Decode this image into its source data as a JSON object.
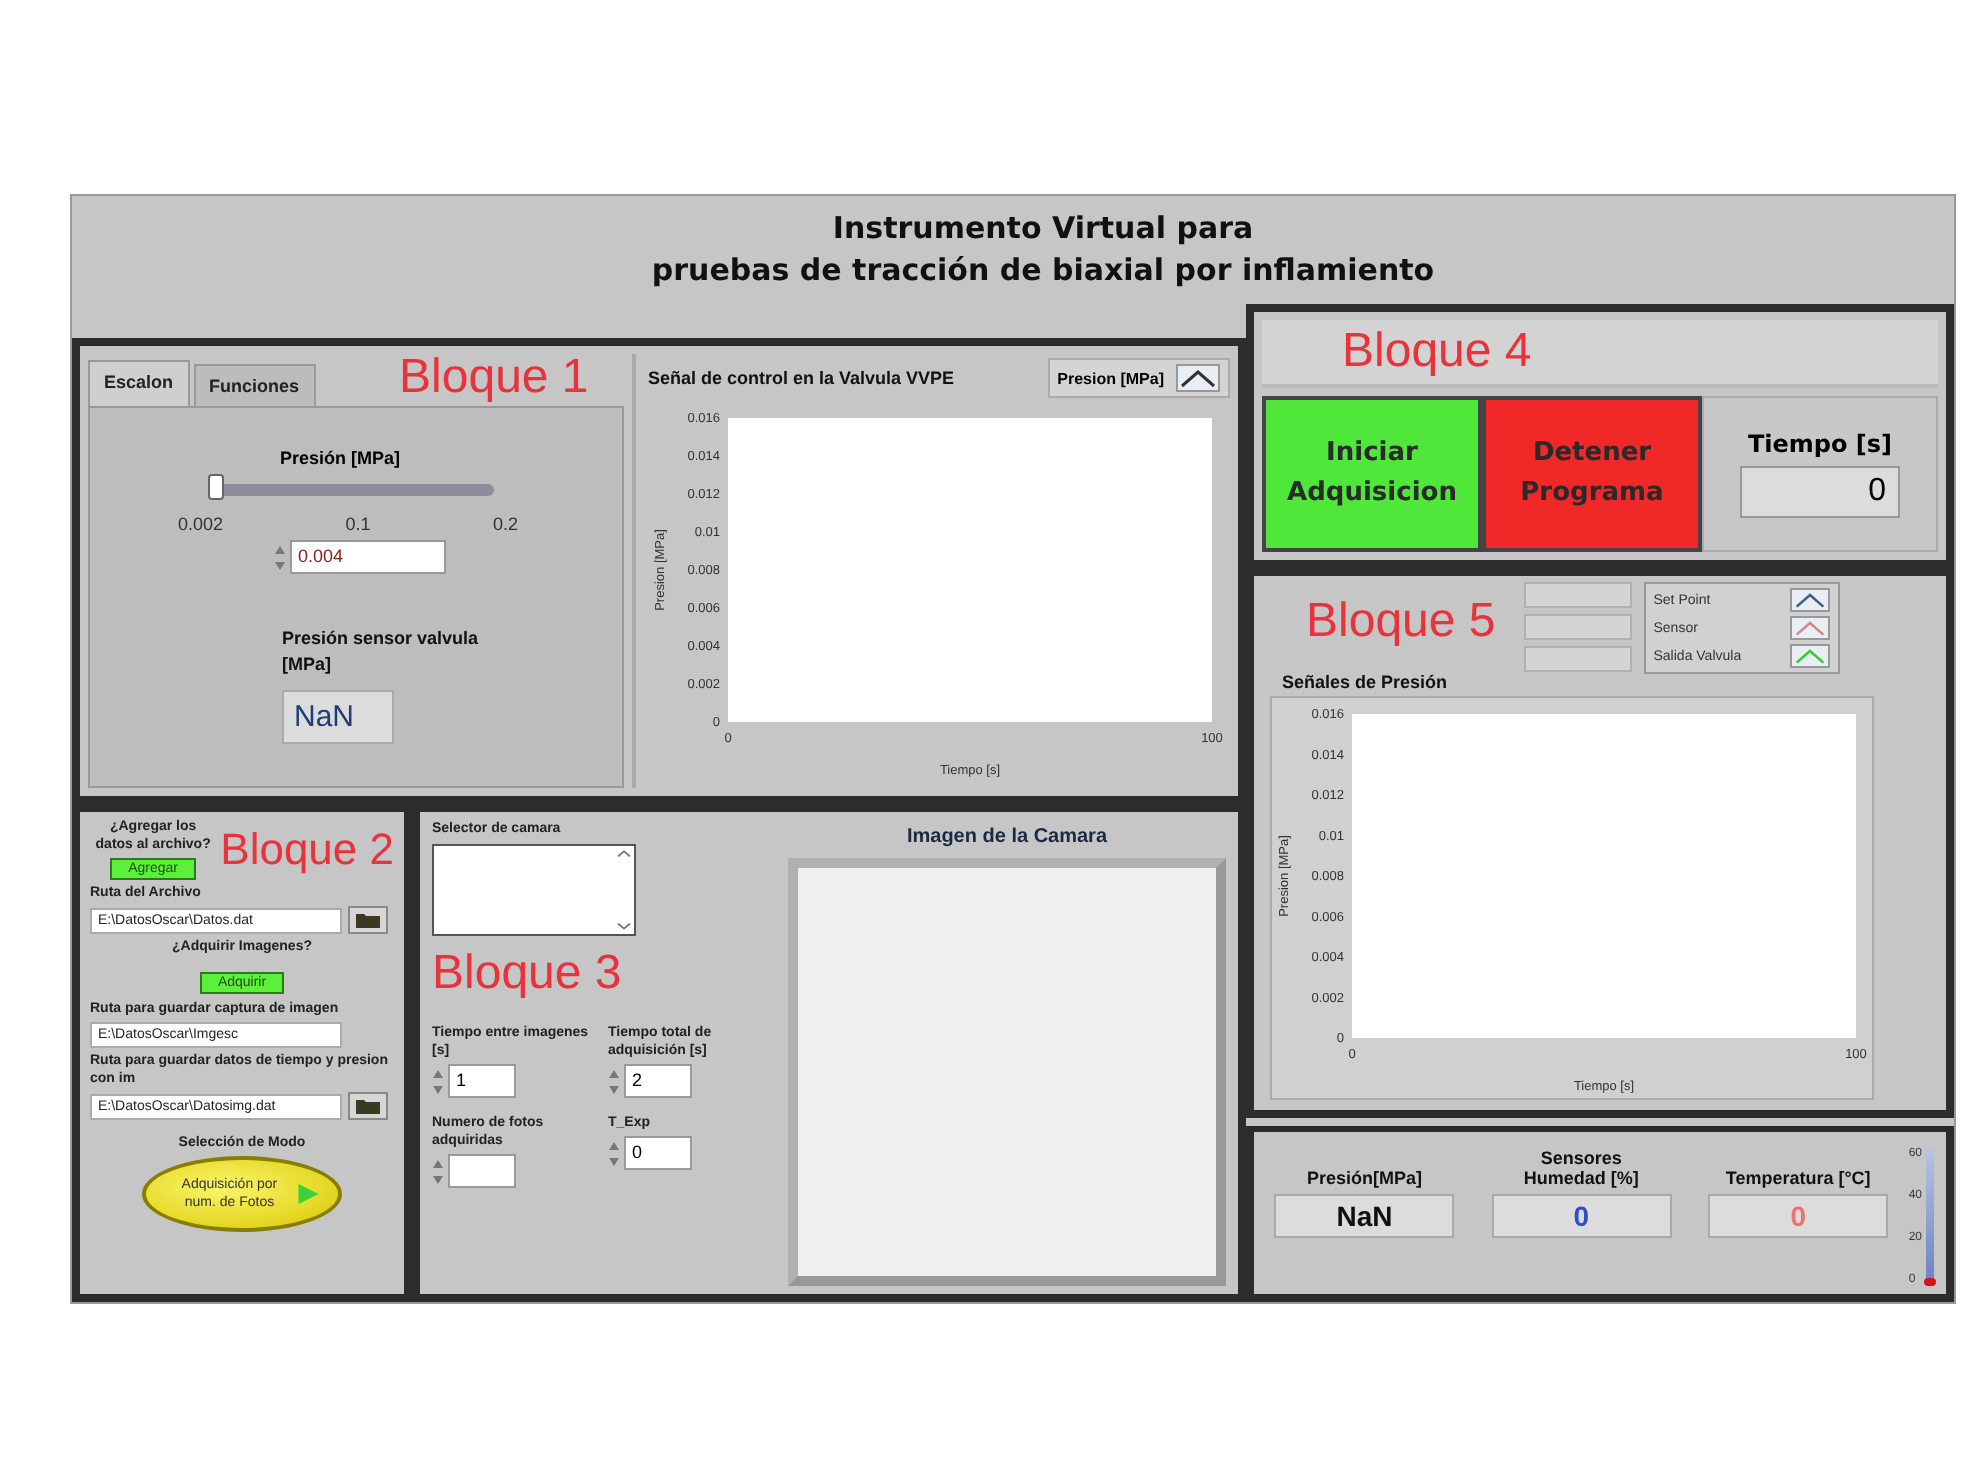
{
  "title": "Instrumento Virtual para\npruebas de tracción de biaxial por inflamiento",
  "bloque1": {
    "label": "Bloque 1",
    "tabs": [
      {
        "label": "Escalon",
        "selected": true
      },
      {
        "label": "Funciones",
        "selected": false
      }
    ],
    "slider": {
      "label": "Presión [MPa]",
      "level": 0.01,
      "ticks": [
        "0.002",
        "0.1",
        "0.2"
      ],
      "value": "0.004"
    },
    "sensor": {
      "label": "Presión sensor valvula [MPa]",
      "value": "NaN"
    },
    "chart": {
      "title": "Señal de control en la Valvula VVPE",
      "legend": "Presion [MPa]",
      "chart_data": {
        "type": "line",
        "xlabel": "Tiempo [s]",
        "ylabel": "Presion [MPa]",
        "xlim": [
          0,
          100
        ],
        "ylim": [
          0,
          0.016
        ],
        "xticks": [
          0,
          100
        ],
        "yticks": [
          0,
          0.002,
          0.004,
          0.006,
          0.008,
          0.01,
          0.012,
          0.014,
          0.016
        ]
      }
    }
  },
  "bloque2": {
    "label": "Bloque 2",
    "agregar": {
      "label": "¿Agregar los datos al archivo?",
      "button": "Agregar"
    },
    "ruta_archivo": {
      "label": "Ruta del Archivo",
      "value": "E:\\DatosOscar\\Datos.dat"
    },
    "adquirir": {
      "label": "¿Adquirir Imagenes?",
      "button": "Adquirir"
    },
    "ruta_imagen": {
      "label": "Ruta para guardar captura de imagen",
      "value": "E:\\DatosOscar\\Imgesc"
    },
    "ruta_datos": {
      "label": "Ruta para guardar datos de tiempo y presion con im",
      "value": "E:\\DatosOscar\\Datosimg.dat"
    },
    "modo": {
      "label": "Selección de Modo",
      "value": "Adquisición por num. de Fotos",
      "on": true
    }
  },
  "bloque3": {
    "label": "Bloque 3",
    "selector": "Selector de camara",
    "image_title": "Imagen de la Camara",
    "fields": [
      {
        "label": "Tiempo entre imagenes [s]",
        "value": "1"
      },
      {
        "label": "Tiempo total de adquisición [s]",
        "value": "2"
      },
      {
        "label": "Numero de fotos adquiridas"
      },
      {
        "label": "T_Exp",
        "value": "0"
      }
    ]
  },
  "bloque4": {
    "label": "Bloque 4",
    "buttons": [
      {
        "label": "Iniciar Adquisicion",
        "color": "#4fe83a"
      },
      {
        "label": "Detener Programa",
        "color": "#f02828"
      }
    ],
    "tiempo": {
      "label": "Tiempo [s]",
      "value": "0"
    }
  },
  "bloque5": {
    "label": "Bloque 5",
    "legend": [
      {
        "name": "Set Point",
        "color": "#3c5f8c"
      },
      {
        "name": "Sensor",
        "color": "#d98585"
      },
      {
        "name": "Salida Valvula",
        "color": "#33cc33"
      }
    ],
    "chart": {
      "title": "Señales de Presión",
      "chart_data": {
        "type": "line",
        "xlabel": "Tiempo [s]",
        "ylabel": "Presion [MPa]",
        "xlim": [
          0,
          100
        ],
        "ylim": [
          0,
          0.016
        ],
        "xticks": [
          0,
          100
        ],
        "yticks": [
          0,
          0.002,
          0.004,
          0.006,
          0.008,
          0.01,
          0.012,
          0.014,
          0.016
        ]
      }
    }
  },
  "sensores": {
    "title": "Sensores",
    "readings": [
      {
        "label": "Presión[MPa]",
        "value": "NaN",
        "color": "#111111"
      },
      {
        "label": "Humedad [%]",
        "value": "0",
        "color": "#2a4fd0"
      },
      {
        "label": "Temperatura [°C]",
        "value": "0",
        "color": "#f07070"
      }
    ],
    "thermometer": {
      "ticks": [
        "60",
        "40",
        "20",
        "0"
      ],
      "level": 0
    }
  }
}
